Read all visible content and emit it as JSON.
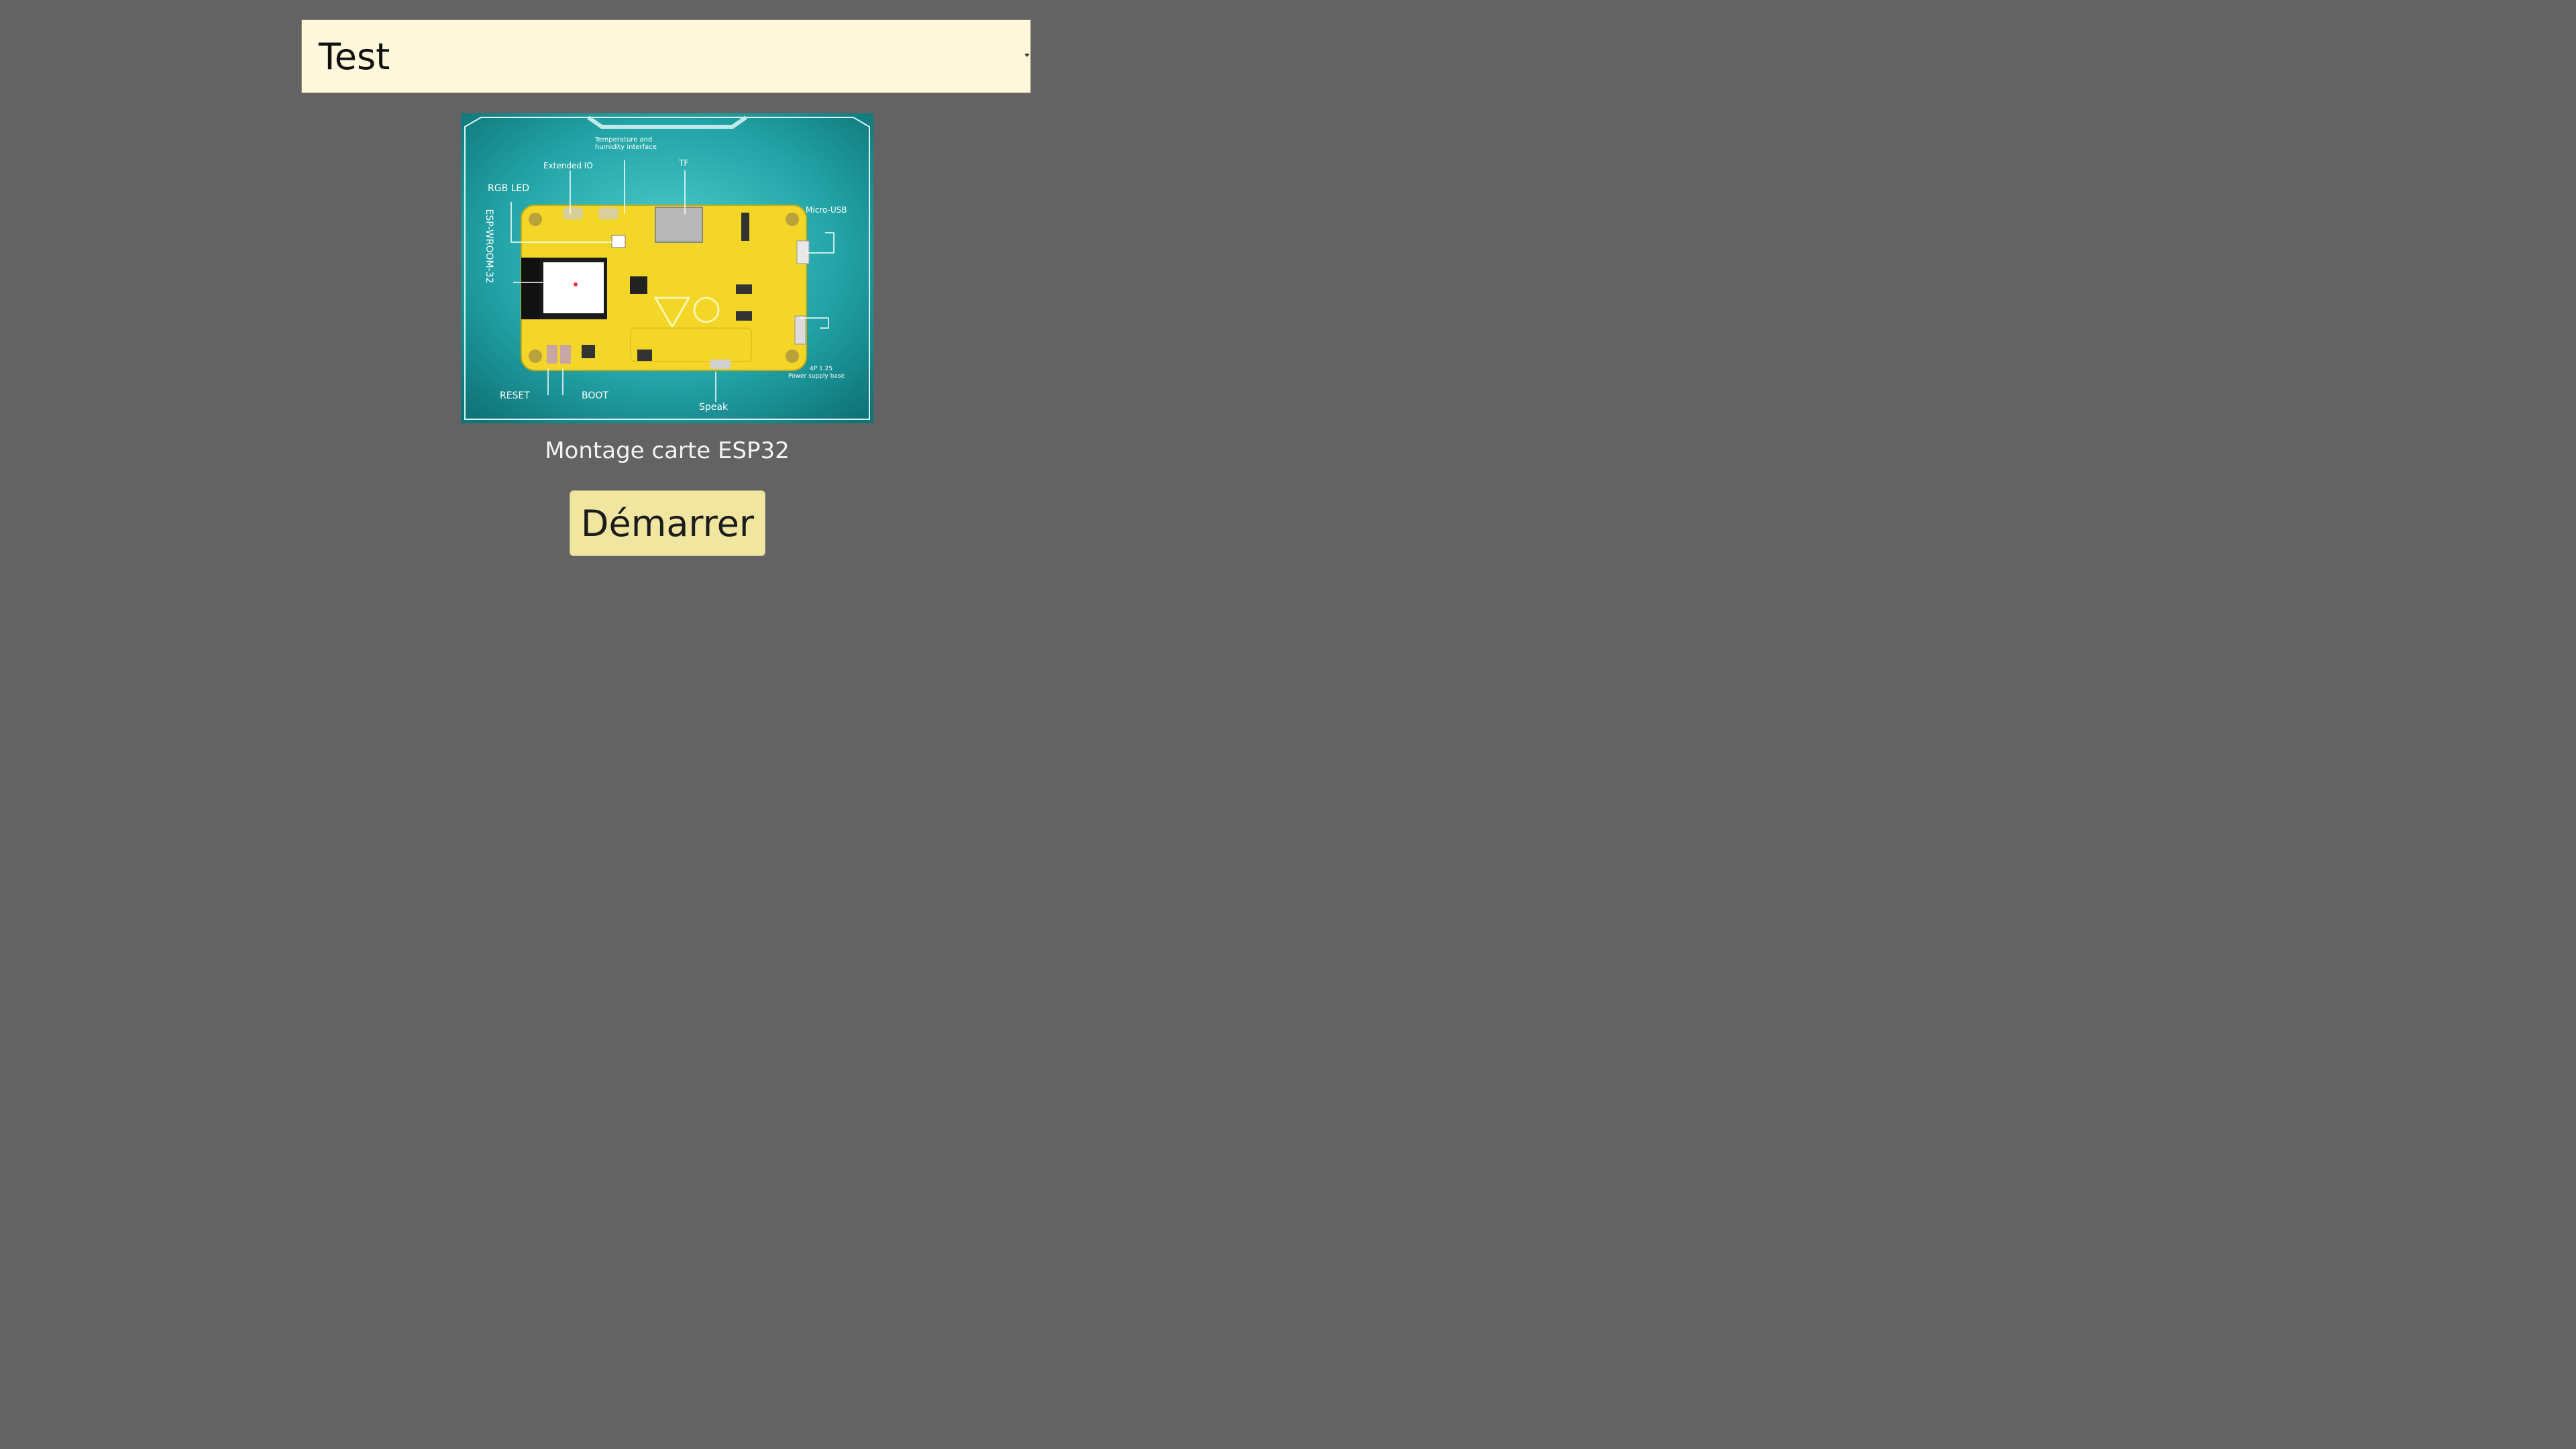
{
  "program_select": {
    "selected_value": "Test"
  },
  "diagram": {
    "labels": {
      "rgb_led": "RGB LED",
      "extended_io": "Extended IO",
      "temp_humidity_line1": "Temperature and",
      "temp_humidity_line2": "humidity interface",
      "tf": "TF",
      "micro_usb": "Micro-USB",
      "esp_module": "ESP-WROOM-32",
      "power_line1": "4P 1.25",
      "power_line2": "Power supply base",
      "reset": "RESET",
      "boot": "BOOT",
      "speak": "Speak"
    },
    "colors": {
      "background": "#1e9aa0",
      "board": "#f2d624"
    }
  },
  "caption": {
    "text": "Montage carte ESP32"
  },
  "start_button": {
    "label": "Démarrer"
  }
}
